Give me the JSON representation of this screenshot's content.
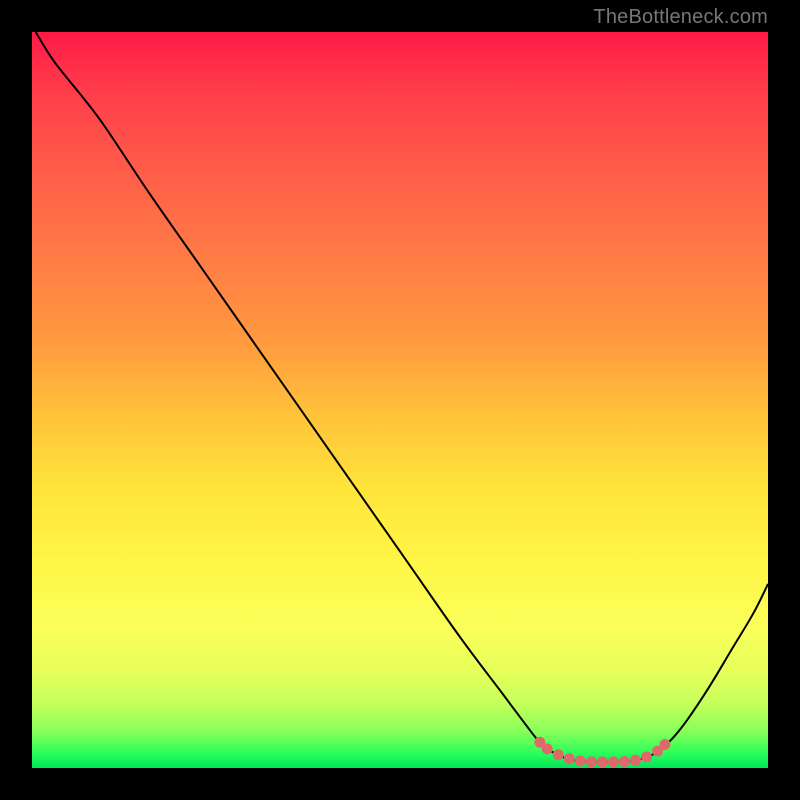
{
  "attribution": "TheBottleneck.com",
  "colors": {
    "marker": "#dd6a6a",
    "curve": "#000000"
  },
  "chart_data": {
    "type": "line",
    "title": "",
    "xlabel": "",
    "ylabel": "",
    "xlim": [
      0,
      100
    ],
    "ylim": [
      0,
      100
    ],
    "grid": false,
    "notes": "Vertical rainbow gradient (red top → green bottom) represents bottleneck severity; black curve shows bottleneck percentage vs. some x-axis parameter; pink markers highlight the near-zero optimal zone.",
    "curve_points": [
      [
        0.5,
        100
      ],
      [
        3,
        96
      ],
      [
        7,
        91
      ],
      [
        10,
        87
      ],
      [
        16,
        78
      ],
      [
        23,
        68
      ],
      [
        30,
        58
      ],
      [
        37,
        48
      ],
      [
        44,
        38
      ],
      [
        51,
        28
      ],
      [
        58,
        18
      ],
      [
        64,
        10
      ],
      [
        67,
        6
      ],
      [
        69,
        3.5
      ],
      [
        71,
        2
      ],
      [
        73,
        1.2
      ],
      [
        75,
        0.9
      ],
      [
        77,
        0.85
      ],
      [
        79,
        0.85
      ],
      [
        81,
        0.9
      ],
      [
        83,
        1.3
      ],
      [
        85,
        2.2
      ],
      [
        87,
        4
      ],
      [
        89,
        6.5
      ],
      [
        92,
        11
      ],
      [
        95,
        16
      ],
      [
        98,
        21
      ],
      [
        100,
        25
      ]
    ],
    "marker_points": [
      [
        69,
        3.5
      ],
      [
        70,
        2.6
      ],
      [
        71.5,
        1.8
      ],
      [
        73,
        1.25
      ],
      [
        74.5,
        0.95
      ],
      [
        76,
        0.85
      ],
      [
        77.5,
        0.83
      ],
      [
        79,
        0.83
      ],
      [
        80.5,
        0.88
      ],
      [
        82,
        1.05
      ],
      [
        83.5,
        1.5
      ],
      [
        85,
        2.3
      ],
      [
        86,
        3.2
      ]
    ]
  }
}
